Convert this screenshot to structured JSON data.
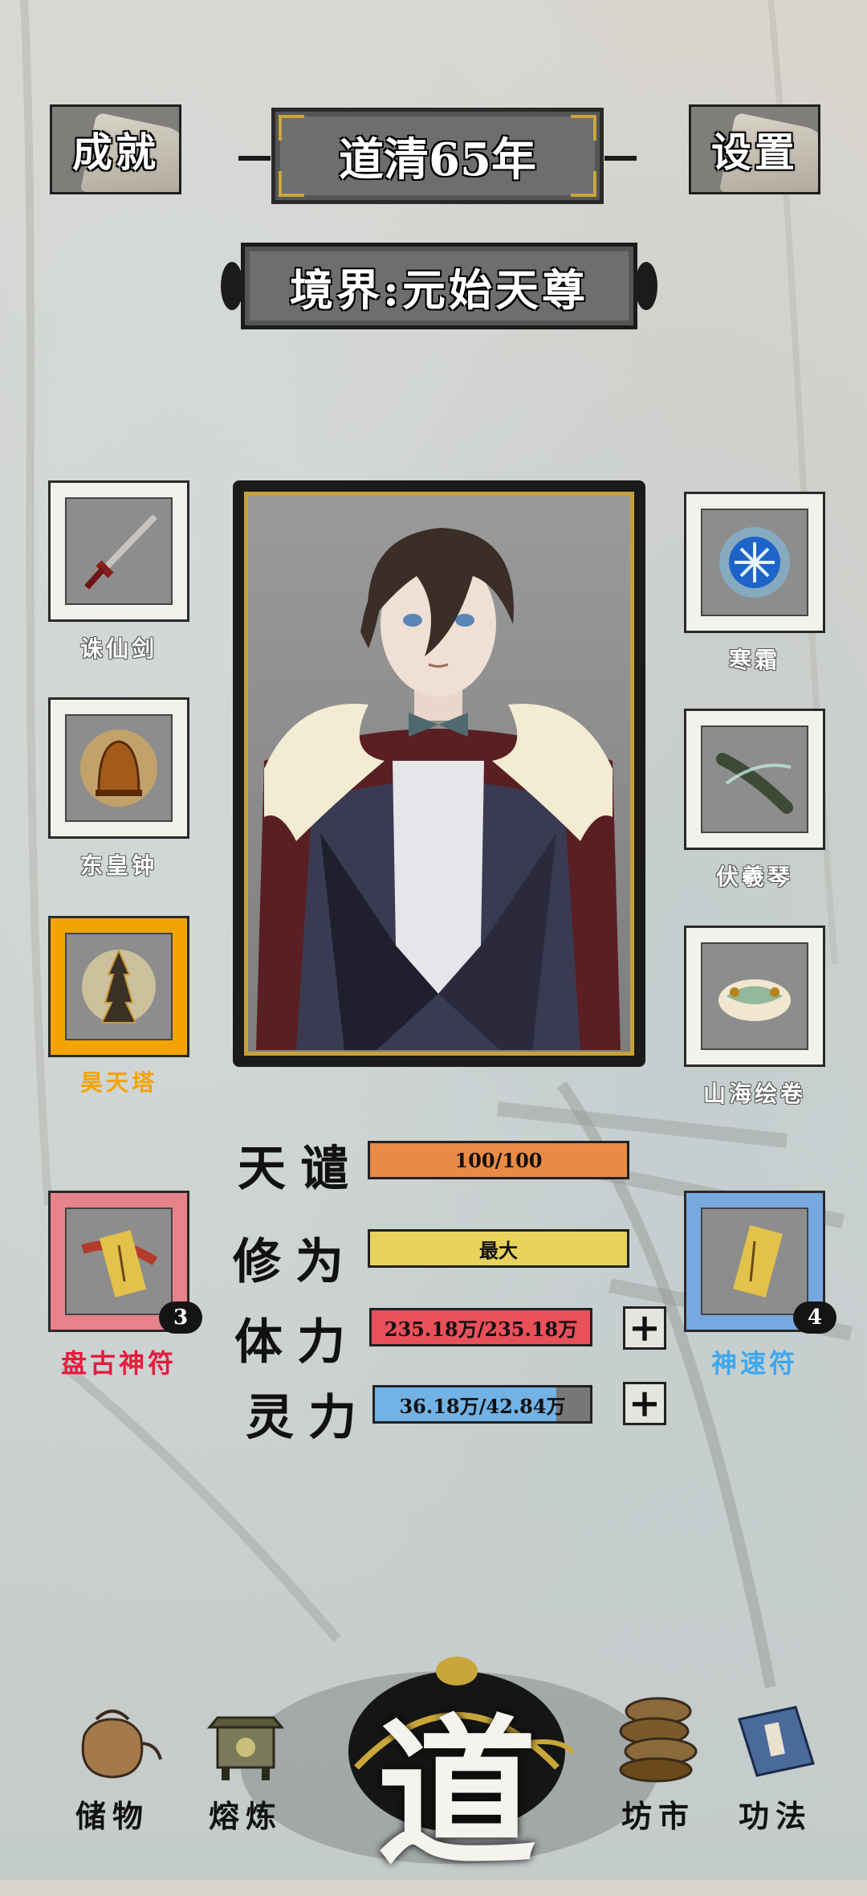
{
  "header": {
    "achievements_label": "成就",
    "year_label": "道清65年",
    "settings_label": "设置",
    "realm_label": "境界:元始天尊"
  },
  "left_slots": [
    {
      "label": "诛仙剑",
      "color": "#ffffff"
    },
    {
      "label": "东皇钟",
      "color": "#ffffff"
    },
    {
      "label": "昊天塔",
      "color": "#f3a400"
    }
  ],
  "right_slots": [
    {
      "label": "寒霜",
      "color": "#ffffff"
    },
    {
      "label": "伏羲琴",
      "color": "#ffffff"
    },
    {
      "label": "山海绘卷",
      "color": "#ffffff"
    }
  ],
  "talismans": {
    "left": {
      "label": "盘古神符",
      "count": "3",
      "color": "#e8193c"
    },
    "right": {
      "label": "神速符",
      "count": "4",
      "color": "#3ea7ef"
    }
  },
  "stats": {
    "tianqian": {
      "name": "天谴",
      "value": "100/100",
      "fill": 1.0,
      "color": "#e98a45"
    },
    "xiuwei": {
      "name": "修为",
      "value": "最大",
      "fill": 1.0,
      "color": "#e7d25d"
    },
    "tili": {
      "name": "体力",
      "value": "235.18万/235.18万",
      "fill": 1.0,
      "color": "#e8505a"
    },
    "lingli": {
      "name": "灵力",
      "value": "36.18万/42.84万",
      "fill": 0.845,
      "color": "#72b2e4"
    }
  },
  "plus_symbol": "+",
  "nav": {
    "storage": "储物",
    "smelt": "熔炼",
    "dao": "道",
    "market": "坊市",
    "skills": "功法"
  }
}
